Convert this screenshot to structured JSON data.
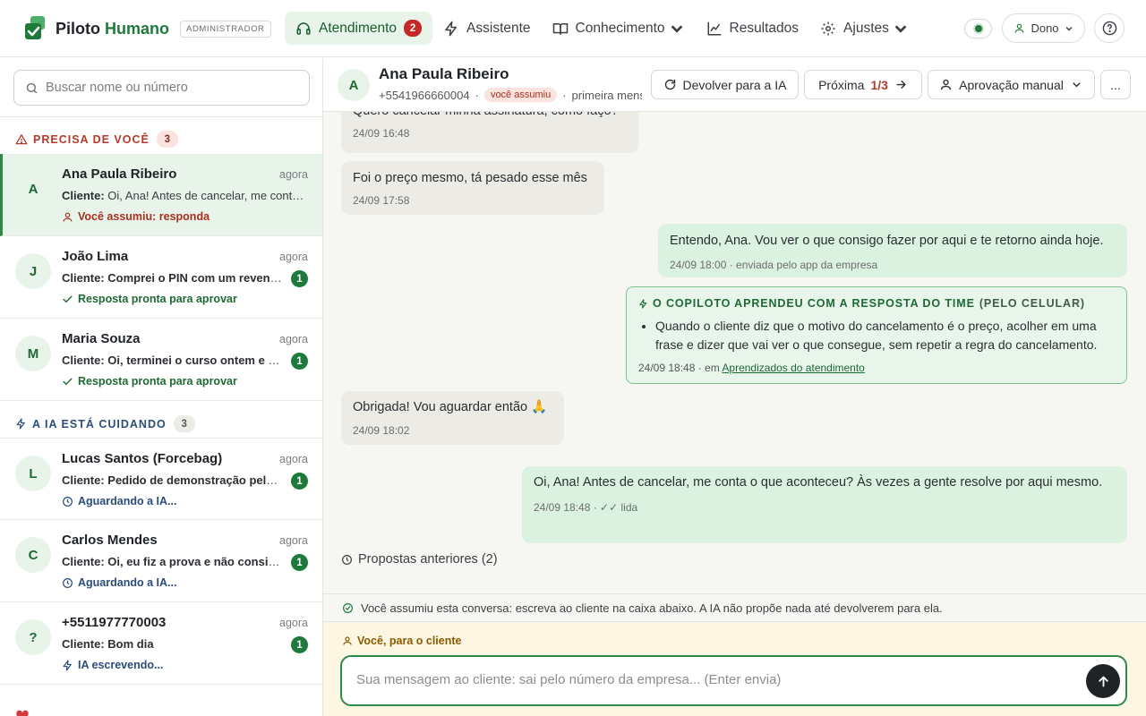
{
  "brand": {
    "name_part1": "Piloto",
    "name_part2": "Humano",
    "role": "ADMINISTRADOR"
  },
  "nav": {
    "atendimento": {
      "label": "Atendimento",
      "badge": "2"
    },
    "assistente": {
      "label": "Assistente"
    },
    "conhecimento": {
      "label": "Conhecimento"
    },
    "resultados": {
      "label": "Resultados"
    },
    "ajustes": {
      "label": "Ajustes"
    }
  },
  "user_menu": {
    "label": "Dono"
  },
  "sidebar": {
    "search_placeholder": "Buscar nome ou número",
    "sections": {
      "urgent": {
        "title": "PRECISA DE VOCÊ",
        "count": "3"
      },
      "ai": {
        "title": "A IA ESTÁ CUIDANDO",
        "count": "3"
      }
    },
    "conversations": [
      {
        "initial": "A",
        "name": "Ana Paula Ribeiro",
        "time": "agora",
        "preview_prefix": "Cliente:",
        "preview": " Oi, Ana! Antes de cancelar, me conta o que aconteceu?",
        "status": "Você assumiu: responda",
        "unread": ""
      },
      {
        "initial": "J",
        "name": "João Lima",
        "time": "agora",
        "preview_prefix": "Cliente:",
        "preview": " Comprei o PIN com um revendedor e não chegou",
        "status": "Resposta pronta para aprovar",
        "unread": "1"
      },
      {
        "initial": "M",
        "name": "Maria Souza",
        "time": "agora",
        "preview_prefix": "Cliente:",
        "preview": " Oi, terminei o curso ontem e o certificado",
        "status": "Resposta pronta para aprovar",
        "unread": "1"
      },
      {
        "initial": "L",
        "name": "Lucas Santos (Forcebag)",
        "time": "agora",
        "preview_prefix": "Cliente:",
        "preview": " Pedido de demonstração pelo site",
        "status": "Aguardando a IA...",
        "unread": "1"
      },
      {
        "initial": "C",
        "name": "Carlos Mendes",
        "time": "agora",
        "preview_prefix": "Cliente:",
        "preview": " Oi, eu fiz a prova e não consigo ver a nota",
        "status": "Aguardando a IA...",
        "unread": "1"
      },
      {
        "initial": "?",
        "name": "+5511977770003",
        "time": "agora",
        "preview_prefix": "Cliente:",
        "preview": " Bom dia",
        "status": "IA escrevendo...",
        "unread": "1"
      }
    ]
  },
  "chat": {
    "initial": "A",
    "name": "Ana Paula Ribeiro",
    "phone": "+5541966660004",
    "tag": "você assumiu",
    "meta_extra": "primeira mensagem",
    "buttons": {
      "return_ai": "Devolver para a IA",
      "next": "Próxima",
      "next_count": "1/3",
      "approval": "Aprovação manual",
      "more": "..."
    },
    "messages": [
      {
        "text": "Quero cancelar minha assinatura, como faço?",
        "time": "24/09 16:48"
      },
      {
        "text": "Foi o preço mesmo, tá pesado esse mês",
        "time": "24/09 17:58"
      },
      {
        "text": "Entendo, Ana. Vou ver o que consigo fazer por aqui e te retorno ainda hoje.",
        "time": "24/09 18:00 · enviada pelo app da empresa"
      },
      {
        "text": "Obrigada! Vou aguardar então 🙏",
        "time": "24/09 18:02"
      },
      {
        "text": "Oi, Ana! Antes de cancelar, me conta o que aconteceu? Às vezes a gente resolve por aqui mesmo.",
        "time": "24/09 18:48 · ✓✓ lida"
      }
    ],
    "learning": {
      "title": "O COPILOTO APRENDEU COM A RESPOSTA DO TIME",
      "subtitle": "(PELO CELULAR)",
      "item": "Quando o cliente diz que o motivo do cancelamento é o preço, acolher em uma frase e dizer que vai ver o que consegue, sem repetir a regra do cancelamento.",
      "footer_prefix": "24/09 18:48 · em",
      "footer_link": "Aprendizados do atendimento"
    },
    "previous_proposals": "Propostas anteriores (2)",
    "notice": "Você assumiu esta conversa: escreva ao cliente na caixa abaixo. A IA não propõe nada até devolverem para ela.",
    "composer": {
      "label": "Você, para o cliente",
      "placeholder": "Sua mensagem ao cliente: sai pelo número da empresa... (Enter envia)"
    }
  },
  "colors": {
    "brand_green": "#1e7a3a",
    "urgent_red": "#b23a2b",
    "ai_blue": "#2a4d7a",
    "badge_red": "#c62828"
  }
}
